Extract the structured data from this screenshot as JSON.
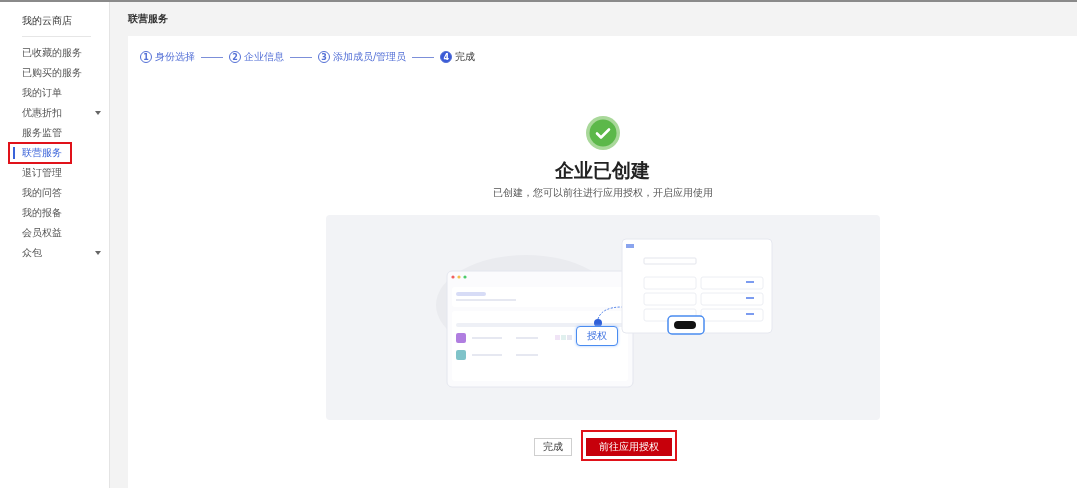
{
  "sidebar": {
    "title": "我的云商店",
    "items": [
      {
        "label": "已收藏的服务",
        "selected": false,
        "has_submenu": false,
        "highlighted": false
      },
      {
        "label": "已购买的服务",
        "selected": false,
        "has_submenu": false,
        "highlighted": false
      },
      {
        "label": "我的订单",
        "selected": false,
        "has_submenu": false,
        "highlighted": false
      },
      {
        "label": "优惠折扣",
        "selected": false,
        "has_submenu": true,
        "highlighted": false
      },
      {
        "label": "服务监管",
        "selected": false,
        "has_submenu": false,
        "highlighted": false
      },
      {
        "label": "联营服务",
        "selected": true,
        "has_submenu": false,
        "highlighted": true
      },
      {
        "label": "退订管理",
        "selected": false,
        "has_submenu": false,
        "highlighted": false
      },
      {
        "label": "我的问答",
        "selected": false,
        "has_submenu": false,
        "highlighted": false
      },
      {
        "label": "我的报备",
        "selected": false,
        "has_submenu": false,
        "highlighted": false
      },
      {
        "label": "会员权益",
        "selected": false,
        "has_submenu": false,
        "highlighted": false
      },
      {
        "label": "众包",
        "selected": false,
        "has_submenu": true,
        "highlighted": false
      }
    ]
  },
  "page_title": "联营服务",
  "steps": [
    {
      "number": "1",
      "label": "身份选择",
      "current": false
    },
    {
      "number": "2",
      "label": "企业信息",
      "current": false
    },
    {
      "number": "3",
      "label": "添加成员/管理员",
      "current": false
    },
    {
      "number": "4",
      "label": "完成",
      "current": true
    }
  ],
  "result": {
    "title": "企业已创建",
    "message": "已创建，您可以前往进行应用授权，开启应用使用"
  },
  "illustration": {
    "kind": "picture",
    "button_label": "授权"
  },
  "buttons": [
    {
      "label": "完成",
      "kind": "secondary",
      "highlighted": false
    },
    {
      "label": "前往应用授权",
      "kind": "primary",
      "highlighted": true
    }
  ]
}
